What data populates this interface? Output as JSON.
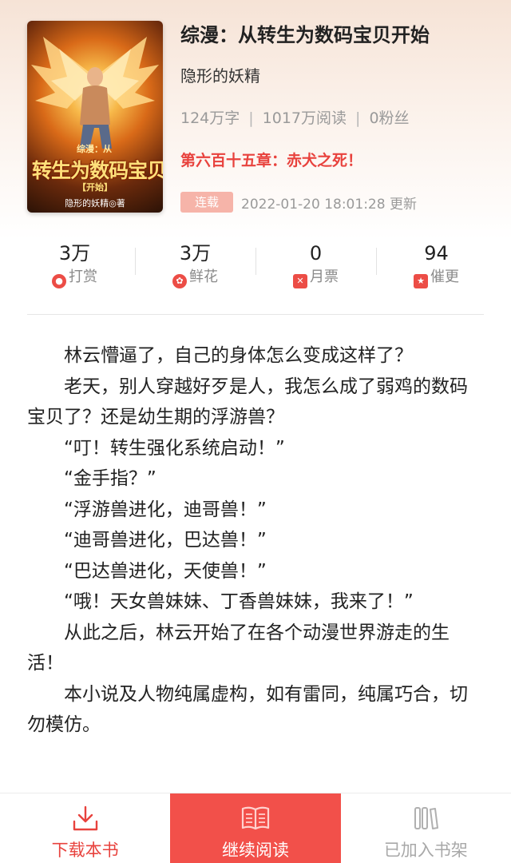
{
  "book": {
    "title": "综漫：从转生为数码宝贝开始",
    "author": "隐形的妖精",
    "word_count": "124万字",
    "reads": "1017万阅读",
    "fans": "0粉丝",
    "latest_chapter": "第六百十五章：赤犬之死！",
    "status": "连载",
    "update_time": "2022-01-20 18:01:28 更新",
    "cover": {
      "prefix": "综漫：从",
      "main_text": "转生为数码宝贝",
      "sub_text": "【开始】",
      "author_line": "隐形的妖精◎著"
    }
  },
  "stats": [
    {
      "value": "3万",
      "label": "打赏",
      "icon": "reward-icon"
    },
    {
      "value": "3万",
      "label": "鲜花",
      "icon": "flower-icon"
    },
    {
      "value": "0",
      "label": "月票",
      "icon": "ticket-icon"
    },
    {
      "value": "94",
      "label": "催更",
      "icon": "urge-update-icon"
    }
  ],
  "synopsis": [
    "林云懵逼了，自己的身体怎么变成这样了？",
    "老天，别人穿越好歹是人，我怎么成了弱鸡的数码宝贝了？还是幼生期的浮游兽？",
    "“叮！转生强化系统启动！”",
    "“金手指？”",
    "“浮游兽进化，迪哥兽！”",
    "“迪哥兽进化，巴达兽！”",
    "“巴达兽进化，天使兽！”",
    "“哦！天女兽妹妹、丁香兽妹妹，我来了！”",
    "从此之后，林云开始了在各个动漫世界游走的生活！",
    "本小说及人物纯属虚构，如有雷同，纯属巧合，切勿模仿。"
  ],
  "bottom_bar": {
    "download": "下载本书",
    "continue_reading": "继续阅读",
    "in_shelf": "已加入书架"
  },
  "colors": {
    "accent": "#f2504a",
    "chapter_red": "#e8423d",
    "badge_bg": "#f6b4a9",
    "muted": "#9a9a9a"
  }
}
